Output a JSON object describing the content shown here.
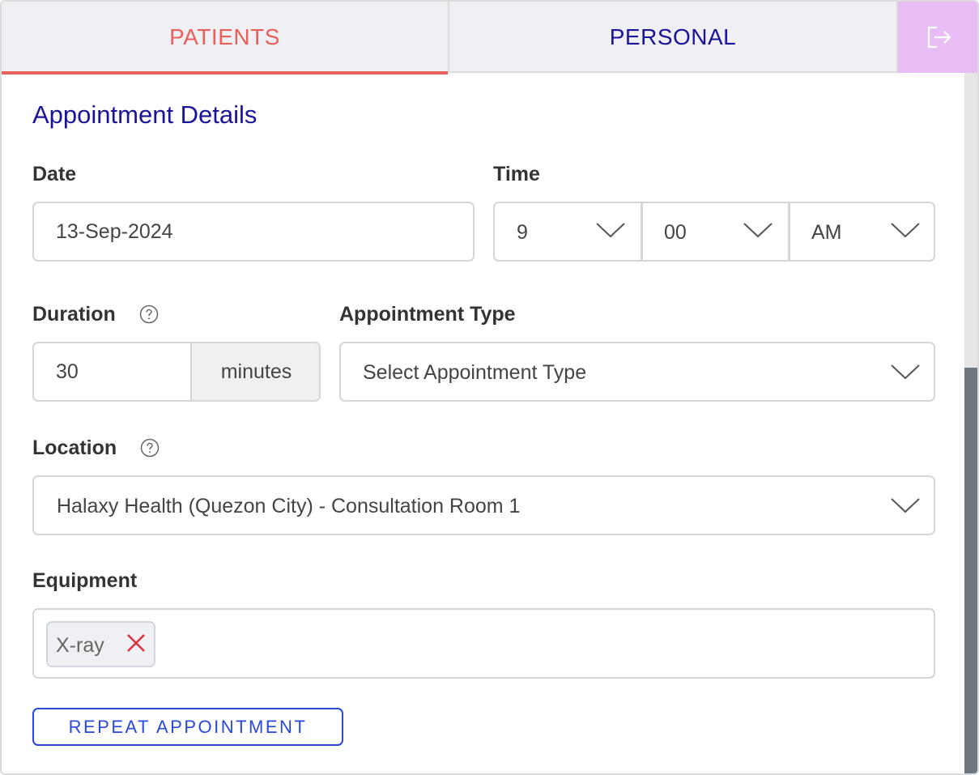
{
  "tabs": {
    "patients_label": "PATIENTS",
    "personal_label": "PERSONAL",
    "active": "patients",
    "logout_icon": "logout-icon"
  },
  "section_title": "Appointment Details",
  "date": {
    "label": "Date",
    "value": "13-Sep-2024"
  },
  "time": {
    "label": "Time",
    "hour": "9",
    "minute": "00",
    "period": "AM"
  },
  "duration": {
    "label": "Duration",
    "value": "30",
    "unit": "minutes",
    "help_icon": "help-circle-icon"
  },
  "appointment_type": {
    "label": "Appointment Type",
    "placeholder": "Select Appointment Type"
  },
  "location": {
    "label": "Location",
    "value": "Halaxy Health (Quezon City) - Consultation Room 1",
    "help_icon": "help-circle-icon"
  },
  "equipment": {
    "label": "Equipment",
    "chips": [
      "X-ray"
    ]
  },
  "repeat_button": "REPEAT APPOINTMENT",
  "colors": {
    "patients_tab": "#e8605c",
    "personal_tab": "#1a1499",
    "logout_bg": "#e8bdf5",
    "title": "#1a1499",
    "button": "#2849d9",
    "remove_x": "#d9333f"
  }
}
